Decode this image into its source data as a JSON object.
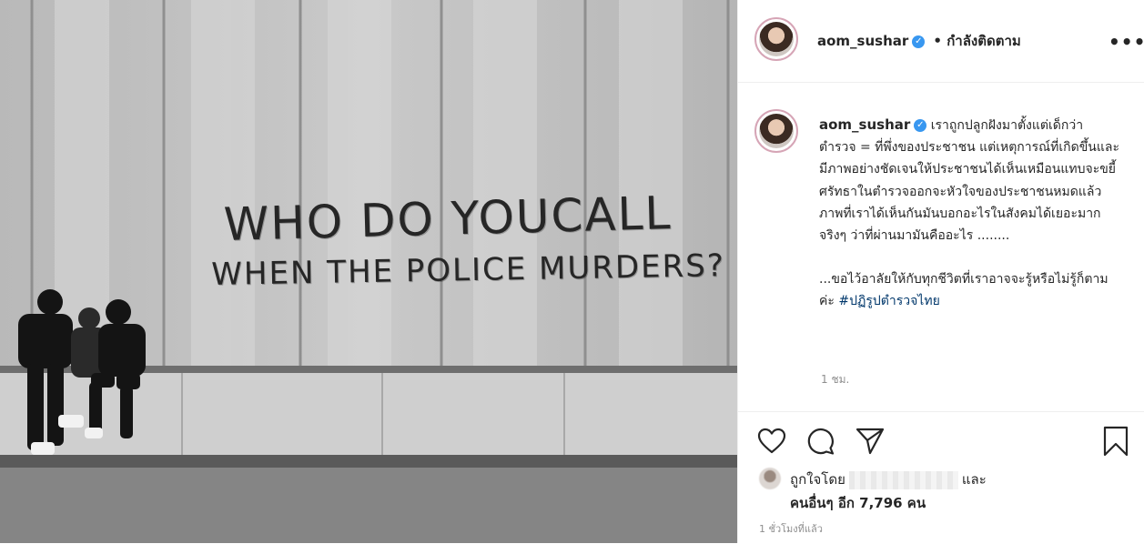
{
  "header": {
    "username": "aom_sushar",
    "verified_glyph": "✓",
    "follow_status": "• กำลังติดตาม",
    "more_icon": "more-horizontal-icon",
    "more_glyph": "•••"
  },
  "photo": {
    "graffiti_line1": "WHO DO YOUCALL",
    "graffiti_line2": "WHEN THE POLICE MURDERS?"
  },
  "caption": {
    "username": "aom_sushar",
    "text1": "เราถูกปลูกฝังมาตั้งแต่เด็กว่าตำรวจ = ที่พึ่งของประชาชน แต่เหตุการณ์ที่เกิดขึ้นและมีภาพอย่างชัดเจนให้ประชาชนได้เห็นเหมือนแทบจะขยี้ศรัทธาในตำรวจออกจะหัวใจของประชาชนหมดแล้ว ภาพที่เราได้เห็นกันมันบอกอะไรในสังคมได้เยอะมากจริงๆ ว่าที่ผ่านมามันคืออะไร ........",
    "text2": "...ขอไว้อาลัยให้กับทุกชีวิตที่เราอาจจะรู้หรือไม่รู้ก็ตามค่ะ",
    "hashtag": "#ปฏิรูปตำรวจไทย",
    "time": "1 ชม."
  },
  "actions": {
    "like_icon": "heart-icon",
    "comment_icon": "comment-icon",
    "share_icon": "send-icon",
    "save_icon": "bookmark-icon"
  },
  "likes": {
    "prefix": "ถูกใจโดย",
    "suffix": "และ",
    "others": "คนอื่นๆ อีก 7,796 คน"
  },
  "posted_time": "1 ชั่วโมงที่แล้ว",
  "colors": {
    "link": "#00376b",
    "verified": "#3897f0",
    "muted": "#8e8e8e"
  }
}
